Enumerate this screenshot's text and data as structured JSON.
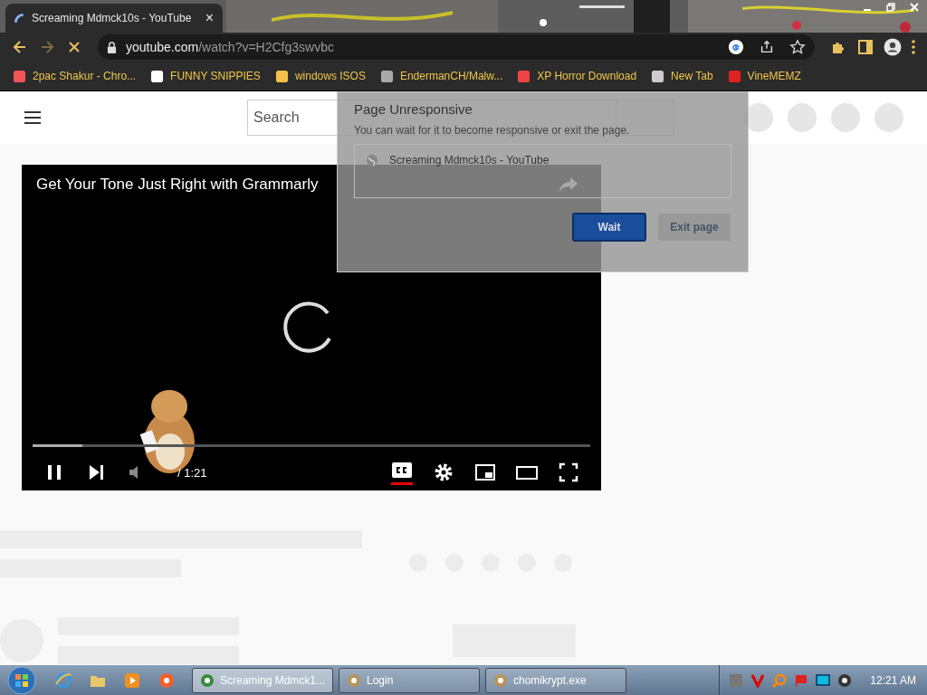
{
  "browser": {
    "tab": {
      "title": "Screaming Mdmck10s - YouTube",
      "close": "×",
      "loading": true
    },
    "url": {
      "host": "youtube.com",
      "path": "/watch?v=H2Cfg3swvbc"
    },
    "bookmarks": [
      {
        "label": "2pac Shakur - Chro..."
      },
      {
        "label": "FUNNY SNIPPIES"
      },
      {
        "label": "windows ISOS"
      },
      {
        "label": "EndermanCH/Malw..."
      },
      {
        "label": "XP Horror Download"
      },
      {
        "label": "New Tab"
      },
      {
        "label": "VineMEMZ"
      }
    ]
  },
  "page": {
    "search": {
      "placeholder": "Search"
    },
    "video": {
      "title": "Get Your Tone Just Right with Grammarly",
      "time": "/ 1:21",
      "level": 0.09,
      "playing": true,
      "captions_on": true
    },
    "dialog": {
      "title": "Page Unresponsive",
      "message": "You can wait for it to become responsive or exit the page.",
      "pages": [
        "Screaming Mdmck10s - YouTube"
      ],
      "buttons": [
        {
          "label": "Wait",
          "primary": true
        },
        {
          "label": "Exit page",
          "primary": false
        }
      ]
    }
  },
  "taskbar": {
    "tasks": [
      {
        "label": "Screaming Mdmck1...",
        "selected": true
      },
      {
        "label": "Login",
        "selected": false
      },
      {
        "label": "chomikrypt.exe",
        "selected": false
      }
    ],
    "clock": "12:21 AM"
  }
}
